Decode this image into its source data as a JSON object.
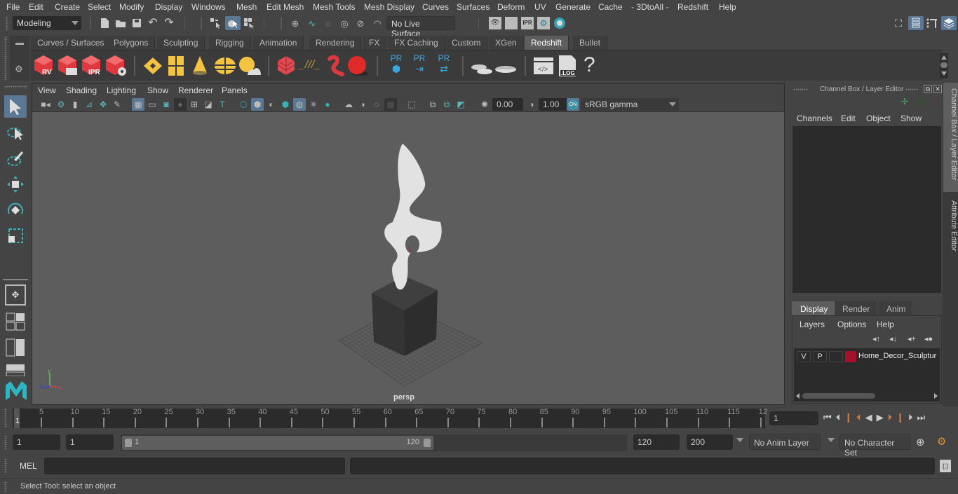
{
  "menubar": {
    "items": [
      "File",
      "Edit",
      "Create",
      "Select",
      "Modify",
      "Display",
      "Windows",
      "Mesh",
      "Edit Mesh",
      "Mesh Tools",
      "Mesh Display",
      "Curves",
      "Surfaces",
      "Deform",
      "UV",
      "Generate",
      "Cache",
      "- 3DtoAll -",
      "Redshift",
      "Help"
    ]
  },
  "statusline": {
    "mode": "Modeling",
    "live_surface": "No Live Surface"
  },
  "shelf": {
    "tabs": [
      "Curves / Surfaces",
      "Polygons",
      "Sculpting",
      "Rigging",
      "Animation",
      "Rendering",
      "FX",
      "FX Caching",
      "Custom",
      "XGen",
      "Redshift",
      "Bullet"
    ],
    "active_tab": "Redshift",
    "icons": {
      "rv": "RV",
      "ipr": "IPR",
      "pr": "PR",
      "log": ".LOG",
      "help": "?"
    }
  },
  "viewport": {
    "menu": [
      "View",
      "Shading",
      "Lighting",
      "Show",
      "Renderer",
      "Panels"
    ],
    "exposure": "0.00",
    "gamma": "1.00",
    "color_mgmt_on": "ON",
    "color_space": "sRGB gamma",
    "camera_label": "persp",
    "axis": {
      "x": "x",
      "y": "y",
      "z": "z"
    }
  },
  "channel_box": {
    "title": "Channel Box / Layer Editor",
    "menu": [
      "Channels",
      "Edit",
      "Object",
      "Show"
    ]
  },
  "layer_editor": {
    "tabs": [
      "Display",
      "Render",
      "Anim"
    ],
    "active_tab": "Display",
    "menu": [
      "Layers",
      "Options",
      "Help"
    ],
    "layers": [
      {
        "v": "V",
        "p": "P",
        "color": "#a3122a",
        "name": "Home_Decor_Sculptur"
      }
    ]
  },
  "side_tabs": [
    "Channel Box / Layer Editor",
    "Attribute Editor"
  ],
  "timeline": {
    "start_label": "1",
    "ticks": [
      "5",
      "10",
      "15",
      "20",
      "25",
      "30",
      "35",
      "40",
      "45",
      "50",
      "55",
      "60",
      "65",
      "70",
      "75",
      "80",
      "85",
      "90",
      "95",
      "100",
      "105",
      "110",
      "115",
      "12"
    ],
    "current_frame": "1"
  },
  "range": {
    "start": "1",
    "playback_start": "1",
    "slider_start": "1",
    "slider_end": "120",
    "playback_end": "120",
    "end": "200",
    "anim_layer": "No Anim Layer",
    "character_set": "No Character Set"
  },
  "command_line": {
    "label": "MEL",
    "value": ""
  },
  "help_line": {
    "text": "Select Tool: select an object"
  }
}
